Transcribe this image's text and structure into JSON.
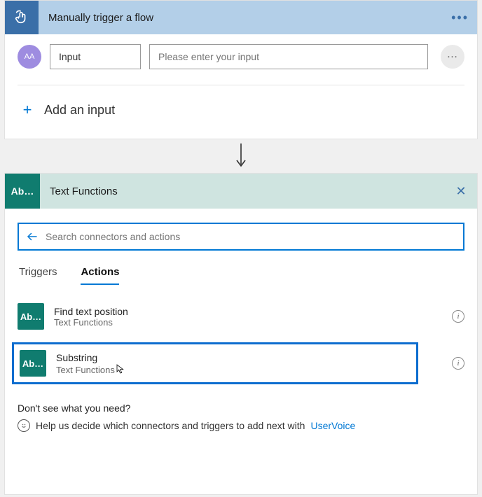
{
  "trigger": {
    "title": "Manually trigger a flow",
    "chip_label": "AA",
    "input_name": "Input",
    "input_placeholder": "Please enter your input",
    "add_input_label": "Add an input"
  },
  "text_functions": {
    "icon_label": "Ab…",
    "title": "Text Functions",
    "search_placeholder": "Search connectors and actions",
    "tabs": {
      "triggers": "Triggers",
      "actions": "Actions"
    },
    "actions": [
      {
        "name": "Find text position",
        "connector": "Text Functions",
        "icon": "Ab…"
      },
      {
        "name": "Substring",
        "connector": "Text Functions",
        "icon": "Ab…"
      }
    ],
    "help": {
      "question": "Don't see what you need?",
      "line_prefix": "Help us decide which connectors and triggers to add next with ",
      "link_text": "UserVoice"
    }
  },
  "colors": {
    "accent": "#0078d4",
    "teal": "#107c6f",
    "blue_header": "#b3cfe8"
  }
}
